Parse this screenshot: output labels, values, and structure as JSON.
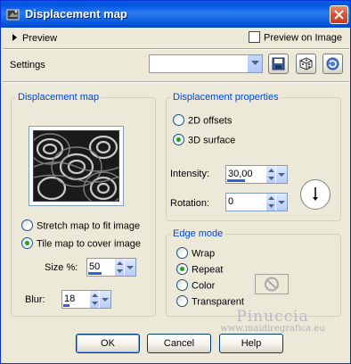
{
  "window": {
    "title": "Displacement map"
  },
  "preview": {
    "label": "Preview",
    "preview_on_image_label": "Preview on Image",
    "preview_on_image_checked": false
  },
  "settings": {
    "label": "Settings",
    "value": ""
  },
  "map_group": {
    "title": "Displacement map",
    "stretch_label": "Stretch map to fit image",
    "tile_label": "Tile map to cover image",
    "selected": "tile",
    "size_label": "Size %:",
    "size_value": "50",
    "size_fraction": 0.5,
    "blur_label": "Blur:",
    "blur_value": "18",
    "blur_fraction": 0.18
  },
  "properties_group": {
    "title": "Displacement properties",
    "offsets_label": "2D offsets",
    "surface_label": "3D surface",
    "selected": "3d_surface",
    "intensity_label": "Intensity:",
    "intensity_value": "30,00",
    "intensity_fraction": 0.3,
    "rotation_label": "Rotation:",
    "rotation_value": "0"
  },
  "edge_group": {
    "title": "Edge mode",
    "wrap_label": "Wrap",
    "repeat_label": "Repeat",
    "color_label": "Color",
    "transparent_label": "Transparent",
    "selected": "repeat"
  },
  "buttons": {
    "ok": "OK",
    "cancel": "Cancel",
    "help": "Help"
  },
  "watermark": {
    "name": "Pinuccia",
    "site": "www.maidiregrafica.eu"
  },
  "icons": [
    "app-icon",
    "close-icon",
    "preview-triangle-icon",
    "combo-arrow-icon",
    "save-preset-icon",
    "randomize-dice-icon",
    "reset-icon",
    "rotation-dial-icon",
    "no-color-icon"
  ],
  "colors": {
    "titlebar": "#0054e3",
    "group_title": "#0046d5",
    "face": "#ece9d8",
    "close": "#d4523a"
  }
}
